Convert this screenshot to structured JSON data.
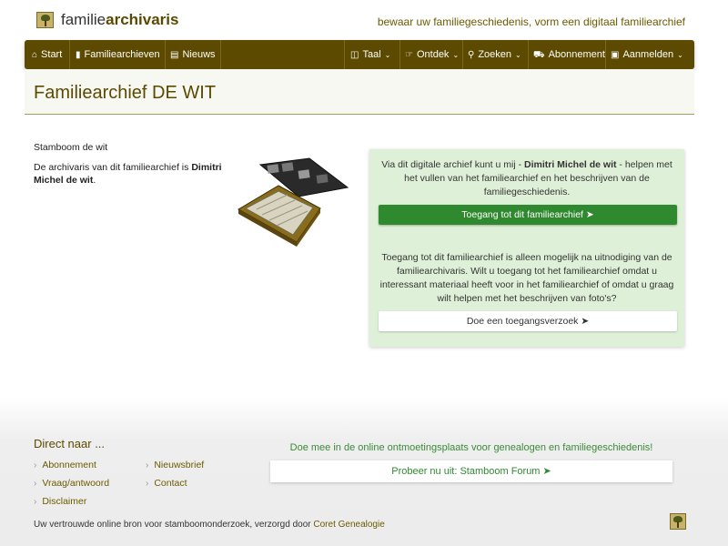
{
  "header": {
    "brand_light": "familie",
    "brand_bold": "archivaris",
    "tagline": "bewaar uw familiegeschiedenis, vorm een digitaal familiearchief"
  },
  "nav": {
    "left": [
      {
        "icon": "home-icon",
        "label": "Start"
      },
      {
        "icon": "book-icon",
        "label": "Familiearchieven"
      },
      {
        "icon": "newspaper-icon",
        "label": "Nieuws"
      }
    ],
    "right": [
      {
        "icon": "language-icon",
        "label": "Taal"
      },
      {
        "icon": "pointer-icon",
        "label": "Ontdek"
      },
      {
        "icon": "search-icon",
        "label": "Zoeken"
      },
      {
        "icon": "cart-icon",
        "label": "Abonnement"
      },
      {
        "icon": "lock-icon",
        "label": "Aanmelden"
      }
    ]
  },
  "page": {
    "title": "Familiearchief DE WIT"
  },
  "left": {
    "line1": "Stamboom de wit",
    "archivist_prefix": "De archivaris van dit familiearchief is ",
    "archivist_name": "Dimitri Michel de wit",
    "archivist_suffix": "."
  },
  "access": {
    "intro_prefix": "Via dit digitale archief kunt u mij - ",
    "intro_name": "Dimitri Michel de wit",
    "intro_suffix": " - helpen met het vullen van het familiearchief en het beschrijven van de familiegeschiedenis.",
    "access_button": "Toegang tot dit familiearchief",
    "invite_text": "Toegang tot dit familiearchief is alleen mogelijk na uitnodiging van de familiearchivaris. Wilt u toegang tot het familiearchief omdat u interessant materiaal heeft voor in het familiearchief of omdat u graag wilt helpen met het beschrijven van foto's?",
    "request_button": "Doe een toegangsverzoek"
  },
  "footer": {
    "heading": "Direct naar ...",
    "links": [
      "Abonnement",
      "Nieuwsbrief",
      "Vraag/antwoord",
      "Contact",
      "Disclaimer"
    ],
    "forum_text": "Doe mee in de online ontmoetingsplaats voor genealogen en familiegeschiedenis!",
    "forum_button": "Probeer nu uit: Stamboom Forum",
    "note_prefix": "Uw vertrouwde online bron voor stamboomonderzoek, verzorgd door ",
    "note_link": "Coret Genealogie"
  },
  "colors": {
    "nav_bg": "#5c4a00",
    "accent_green": "#2f8a2f",
    "panel_bg": "#dff0d8",
    "brand_text": "#5a4a00"
  }
}
